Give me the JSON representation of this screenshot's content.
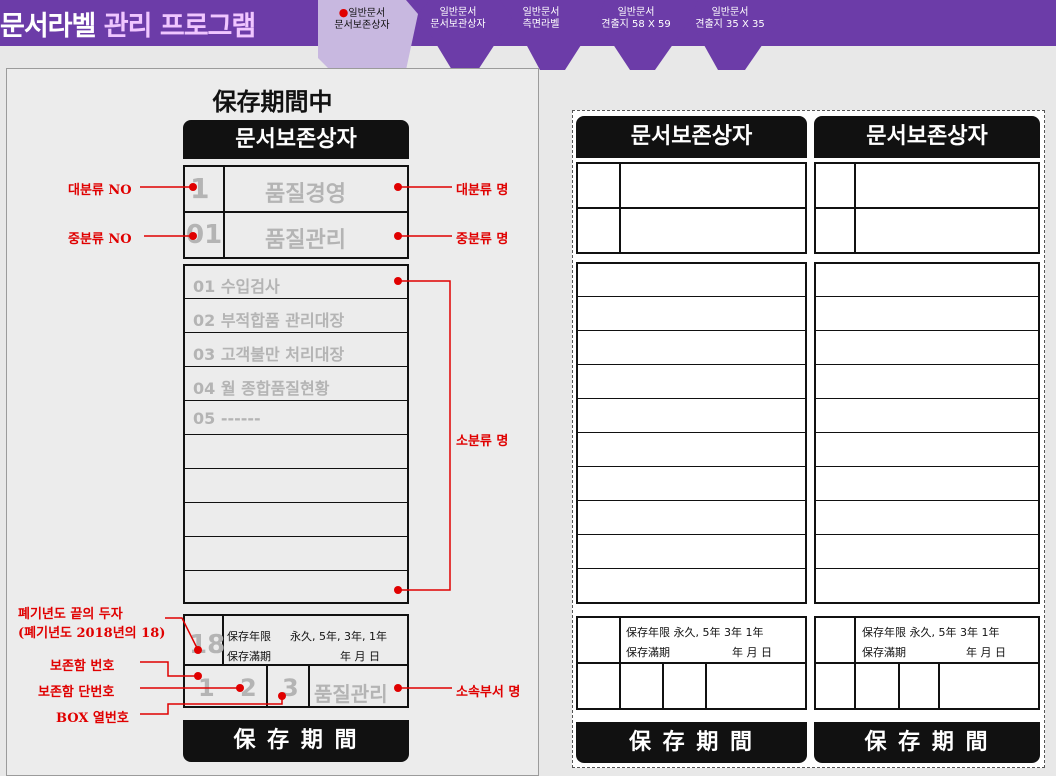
{
  "app": {
    "brand_part1": "문서라벨",
    "brand_part2": "관리 프로그램"
  },
  "tabs": [
    {
      "line1": "일반문서",
      "line2": "문서보존상자",
      "active": true
    },
    {
      "line1": "일반문서",
      "line2": "문서보관상자",
      "active": false
    },
    {
      "line1": "일반문서",
      "line2": "측면라벨",
      "active": false
    },
    {
      "line1": "일반문서",
      "line2": "견출지 58 X 59",
      "active": false
    },
    {
      "line1": "일반문서",
      "line2": "견출지 35 X 35",
      "active": false
    }
  ],
  "colors": {
    "header": "#6c3ca8",
    "active_tab": "#c8b8e0",
    "annotation": "#e00000",
    "placeholder": "#b4b4b4"
  },
  "template": {
    "title": "保存期間中",
    "box_header": "문서보존상자",
    "footer": "保 存 期 間",
    "major_no": "1",
    "major_name": "품질경영",
    "mid_no": "01",
    "mid_name": "품질관리",
    "sub_items": [
      "01  수입검사",
      "02  부적합품 관리대장",
      "03  고객불만 처리대장",
      "04  월 종합품질현황",
      "05  ------"
    ],
    "disposal_year": "18",
    "retention_label": "保存年限",
    "retention_values": "永久, 5年, 3年, 1年",
    "expiry_label": "保存滿期",
    "expiry_units": "年   月   日",
    "storage_no": "1",
    "storage_tier": "2",
    "box_col": "3",
    "department": "품질관리"
  },
  "annotations": {
    "major_no": "대분류 NO",
    "major_name": "대분류 명",
    "mid_no": "중분류 NO",
    "mid_name": "중분류 명",
    "sub_name": "소분류 명",
    "disposal_line1": "폐기년도 끝의 두자",
    "disposal_line2": "(폐기년도 2018년의 18)",
    "storage_no": "보존함 번호",
    "storage_tier": "보존함 단번호",
    "box_col": "BOX 열번호",
    "department": "소속부서 명"
  },
  "preview": {
    "header": "문서보존상자",
    "retention": "保存年限  永久, 5年 3年 1年",
    "expiry_label": "保存滿期",
    "expiry_units": "年   月   日",
    "footer": "保 存 期 間"
  }
}
